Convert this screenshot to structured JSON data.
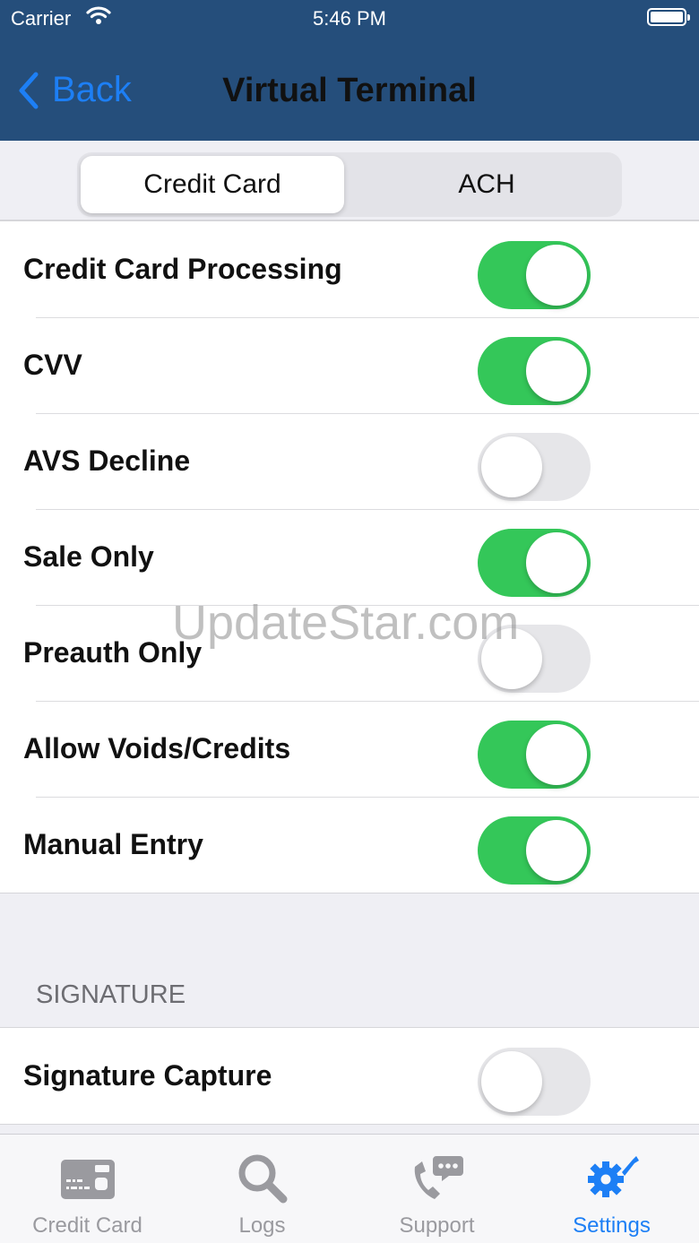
{
  "status_bar": {
    "carrier": "Carrier",
    "time": "5:46 PM"
  },
  "nav": {
    "back_label": "Back",
    "title": "Virtual Terminal"
  },
  "segments": [
    {
      "label": "Credit Card",
      "selected": true
    },
    {
      "label": "ACH",
      "selected": false
    }
  ],
  "settings": [
    {
      "label": "Credit Card Processing",
      "on": true
    },
    {
      "label": "CVV",
      "on": true
    },
    {
      "label": "AVS Decline",
      "on": false
    },
    {
      "label": "Sale Only",
      "on": true
    },
    {
      "label": "Preauth Only",
      "on": false
    },
    {
      "label": "Allow Voids/Credits",
      "on": true
    },
    {
      "label": "Manual Entry",
      "on": true
    }
  ],
  "signature_section": {
    "header": "SIGNATURE",
    "items": [
      {
        "label": "Signature Capture",
        "on": false
      }
    ]
  },
  "tabs": [
    {
      "label": "Credit Card",
      "icon": "credit-card-icon",
      "active": false
    },
    {
      "label": "Logs",
      "icon": "search-icon",
      "active": false
    },
    {
      "label": "Support",
      "icon": "phone-chat-icon",
      "active": false
    },
    {
      "label": "Settings",
      "icon": "gears-wrench-icon",
      "active": true
    }
  ],
  "watermark": "UpdateStar.com",
  "colors": {
    "nav_bar": "#254e7b",
    "accent": "#1d7ff5",
    "toggle_on": "#34c759",
    "toggle_off": "#e6e6e9"
  }
}
